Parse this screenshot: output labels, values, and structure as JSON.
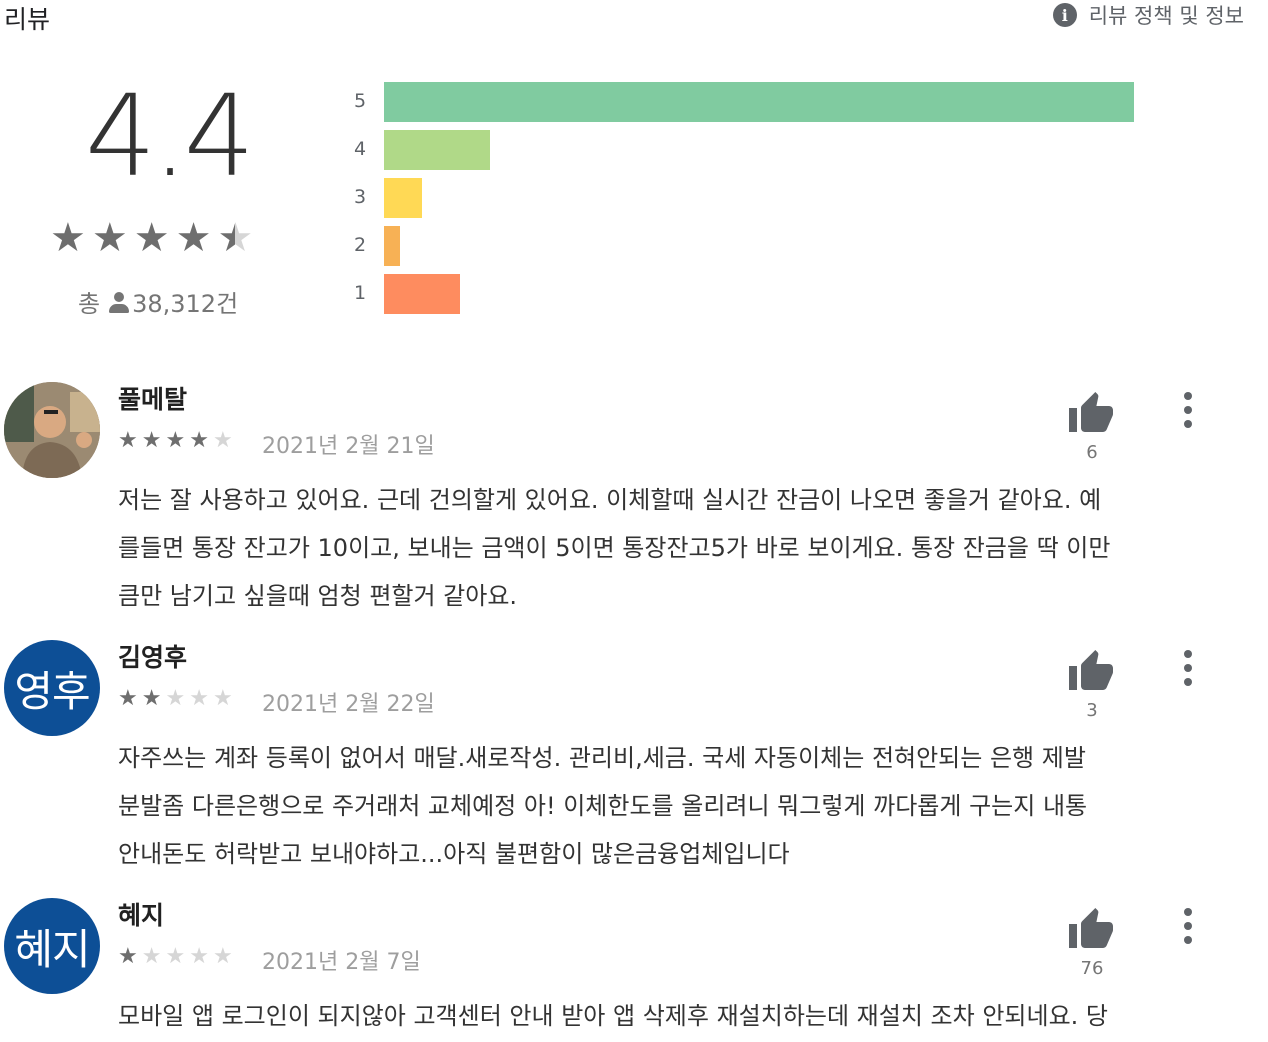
{
  "header": {
    "title": "리뷰",
    "policy_link": "리뷰 정책 및 정보",
    "info_icon": "i"
  },
  "summary": {
    "average": "4.4",
    "stars": 4.4,
    "total_prefix": "총",
    "total_count": "38,312건"
  },
  "histogram": [
    {
      "label": "5",
      "fraction": 1.0,
      "color": "#80cba0"
    },
    {
      "label": "4",
      "fraction": 0.141,
      "color": "#b0d988"
    },
    {
      "label": "3",
      "fraction": 0.051,
      "color": "#ffd955"
    },
    {
      "label": "2",
      "fraction": 0.021,
      "color": "#f7b155"
    },
    {
      "label": "1",
      "fraction": 0.101,
      "color": "#fe8c5f"
    }
  ],
  "reviews": [
    {
      "author": "풀메탈",
      "avatar": {
        "type": "photo",
        "text": ""
      },
      "rating": 4,
      "date": "2021년 2월 21일",
      "likes": "6",
      "text_lines": [
        "저는 잘 사용하고 있어요. 근데 건의할게 있어요. 이체할때 실시간 잔금이 나오면 좋을거 같아요. 예",
        "를들면 통장 잔고가 10이고, 보내는 금액이 5이면 통장잔고5가 바로 보이게요. 통장 잔금을 딱 이만",
        "큼만 남기고 싶을때 엄청 편할거 같아요."
      ]
    },
    {
      "author": "김영후",
      "avatar": {
        "type": "text",
        "text": "영후"
      },
      "rating": 2,
      "date": "2021년 2월 22일",
      "likes": "3",
      "text_lines": [
        "자주쓰는 계좌 등록이 없어서 매달.새로작성. 관리비,세금. 국세 자동이체는 전혀안되는 은행 제발",
        "분발좀 다른은행으로 주거래처 교체예정 아! 이체한도를 올리려니 뭐그렇게 까다롭게 구는지 내통",
        "안내돈도 허락받고 보내야하고...아직 불편함이 많은금융업체입니다"
      ]
    },
    {
      "author": "혜지",
      "avatar": {
        "type": "text",
        "text": "혜지"
      },
      "rating": 1,
      "date": "2021년 2월 7일",
      "likes": "76",
      "text_lines": [
        "모바일 앱 로그인이 되지않아 고객센터 안내 받아 앱 삭제후 재설치하는데 재설치 조차 안되네요. 당"
      ]
    }
  ],
  "icons": {
    "star": "★",
    "thumb": "thumbs-up-icon",
    "more": "more-vert-icon"
  }
}
